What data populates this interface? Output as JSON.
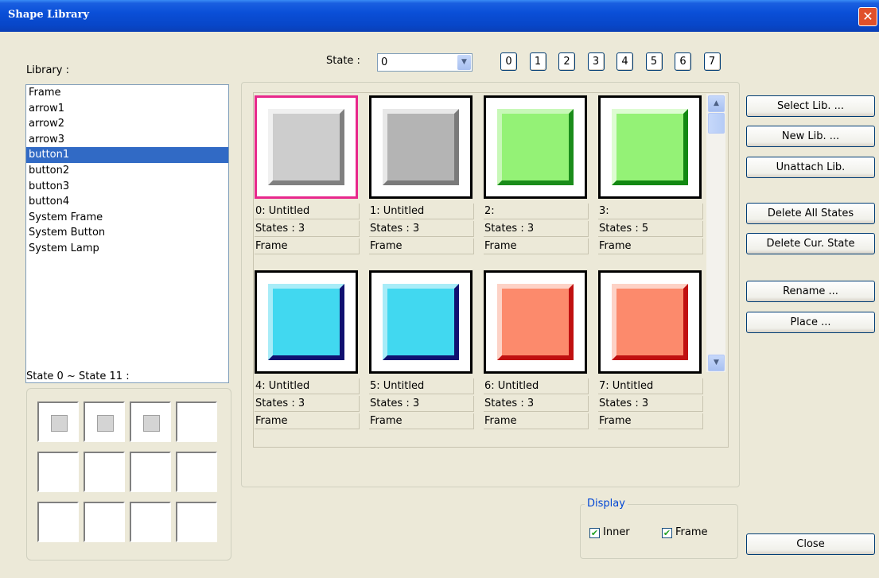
{
  "window": {
    "title": "Shape Library",
    "close_glyph": "✕"
  },
  "library": {
    "label": "Library :",
    "items": [
      "Frame",
      "arrow1",
      "arrow2",
      "arrow3",
      "button1",
      "button2",
      "button3",
      "button4",
      "System Frame",
      "System Button",
      "System Lamp"
    ],
    "selected_index": 4
  },
  "state_range_label": "State 0 ~ State 11 :",
  "state": {
    "label": "State :",
    "value": "0",
    "numbers": [
      "0",
      "1",
      "2",
      "3",
      "4",
      "5",
      "6",
      "7"
    ]
  },
  "shapes": [
    {
      "name": "0: Untitled",
      "states": "States : 3",
      "type": "Frame",
      "fill": "#cdcdcd",
      "light": "#f0f0f0",
      "dark": "#808080"
    },
    {
      "name": "1: Untitled",
      "states": "States : 3",
      "type": "Frame",
      "fill": "#b4b4b4",
      "light": "#e8e8e8",
      "dark": "#7a7a7a"
    },
    {
      "name": "2:",
      "states": "States : 3",
      "type": "Frame",
      "fill": "#94f276",
      "light": "#c8f8b8",
      "dark": "#1a8c1a"
    },
    {
      "name": "3:",
      "states": "States : 5",
      "type": "Frame",
      "fill": "#94f276",
      "light": "#ddfcd2",
      "dark": "#128812"
    },
    {
      "name": "4: Untitled",
      "states": "States : 3",
      "type": "Frame",
      "fill": "#41d8f0",
      "light": "#a8ecf8",
      "dark": "#101070"
    },
    {
      "name": "5: Untitled",
      "states": "States : 3",
      "type": "Frame",
      "fill": "#41d8f0",
      "light": "#a8ecf8",
      "dark": "#101070"
    },
    {
      "name": "6: Untitled",
      "states": "States : 3",
      "type": "Frame",
      "fill": "#fc8a6c",
      "light": "#fdd2c6",
      "dark": "#c01010"
    },
    {
      "name": "7: Untitled",
      "states": "States : 3",
      "type": "Frame",
      "fill": "#fc8a6c",
      "light": "#fdd2c6",
      "dark": "#c01010"
    }
  ],
  "buttons": {
    "select_lib": "Select Lib. ...",
    "new_lib": "New Lib. ...",
    "unattach_lib": "Unattach Lib.",
    "delete_all_states": "Delete All States",
    "delete_cur_state": "Delete Cur. State",
    "rename": "Rename ...",
    "place": "Place ...",
    "close": "Close"
  },
  "display": {
    "label": "Display",
    "inner": "Inner",
    "frame": "Frame",
    "inner_checked": true,
    "frame_checked": true,
    "check_glyph": "✔"
  },
  "scroll": {
    "up_glyph": "▲",
    "down_glyph": "▼",
    "combo_glyph": "▼"
  }
}
